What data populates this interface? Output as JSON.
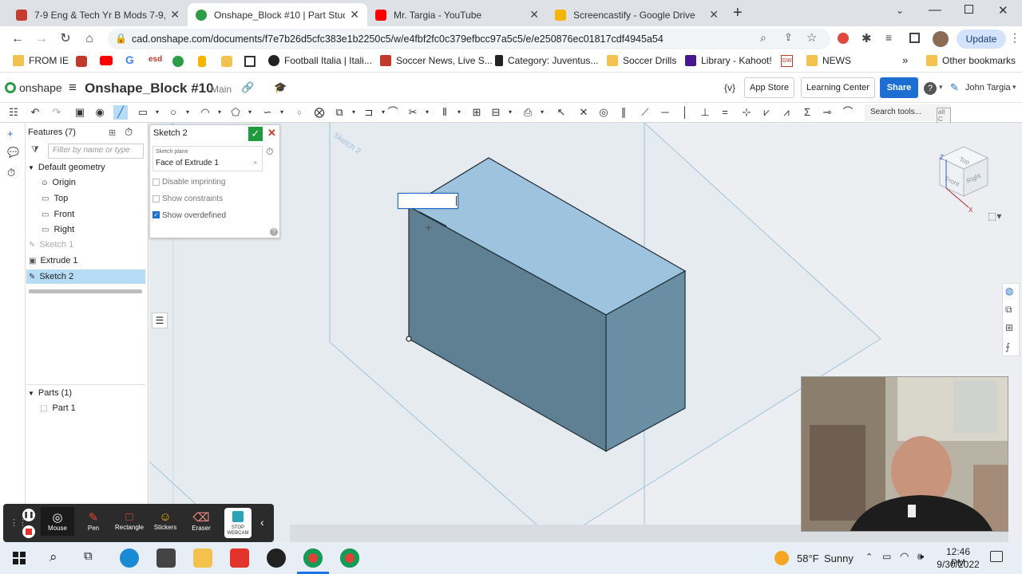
{
  "browser": {
    "tabs": [
      {
        "title": "7-9 Eng & Tech Yr B Mods 7-9, 1s",
        "favicon": "classroom-icon",
        "color": "#c33e2f"
      },
      {
        "title": "Onshape_Block #10 | Part Studio",
        "favicon": "onshape-icon",
        "color": "#2c9d46",
        "active": true
      },
      {
        "title": "Mr. Targia - YouTube",
        "favicon": "youtube-icon",
        "color": "#ff0000"
      },
      {
        "title": "Screencastify - Google Drive",
        "favicon": "drive-icon",
        "color": "#f4b400"
      }
    ],
    "url": "cad.onshape.com/documents/f7e7b26d5cfc383e1b2250c5/w/e4fbf2fc0c379efbcc97a5c5/e/e250876ec01817cdf4945a54",
    "update_label": "Update",
    "bookmarks": [
      "FROM IE",
      "Football Italia | Itali...",
      "Soccer News, Live S...",
      "Category: Juventus...",
      "Soccer Drills",
      "Library - Kahoot!",
      "NEWS"
    ],
    "other_bookmarks": "Other bookmarks"
  },
  "onshape": {
    "logo": "onshape",
    "doc_title": "Onshape_Block #10",
    "branch": "Main",
    "app_store": "App Store",
    "learning_center": "Learning Center",
    "share": "Share",
    "user": "John Targia",
    "search_tools": "Search tools...",
    "search_shortcut": "alt C",
    "brackets": "{v}"
  },
  "features": {
    "header": "Features (7)",
    "filter_placeholder": "Filter by name or type",
    "default_geometry": "Default geometry",
    "items": [
      "Origin",
      "Top",
      "Front",
      "Right"
    ],
    "sketch1": "Sketch 1",
    "extrude1": "Extrude 1",
    "sketch2": "Sketch 2",
    "parts_header": "Parts (1)",
    "part1": "Part 1"
  },
  "sketch_dialog": {
    "title": "Sketch 2",
    "plane_label": "Sketch plane",
    "plane_value": "Face of Extrude 1",
    "opt1": "Disable imprinting",
    "opt2": "Show constraints",
    "opt3": "Show overdefined"
  },
  "viewcube": {
    "top": "Top",
    "front": "Front",
    "right": "Right"
  },
  "viewport": {
    "plane_label": "Sketch 2"
  },
  "screencastify": {
    "tools": [
      "Mouse",
      "Pen",
      "Rectangle",
      "Stickers",
      "Eraser"
    ],
    "webcam": "STOP WEBCAM"
  },
  "taskbar": {
    "temp": "58°F",
    "weather": "Sunny",
    "time": "12:46 PM",
    "date": "9/30/2022"
  },
  "colors": {
    "onshape_blue": "#1c6ed2",
    "selected": "#b7dcf5",
    "face_top": "#9dc3de",
    "face_front": "#5f7f93"
  }
}
